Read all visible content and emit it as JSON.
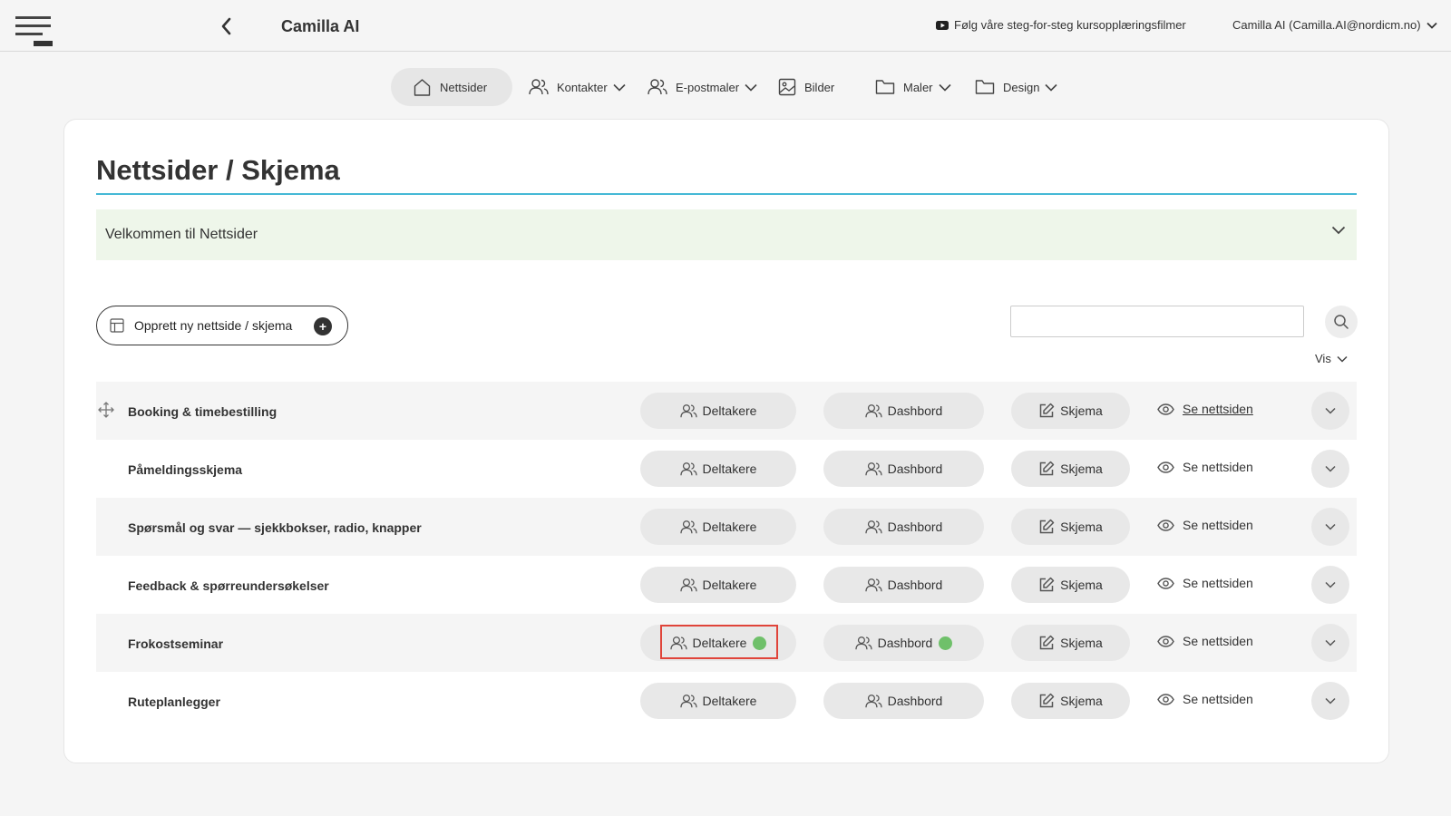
{
  "header": {
    "app_title": "Camilla AI",
    "tutorial_link": "Følg våre steg-for-steg kursopplæringsfilmer",
    "user_label": "Camilla AI (Camilla.AI@nordicm.no)"
  },
  "nav": {
    "items": [
      {
        "label": "Nettsider",
        "icon": "home-icon",
        "active": true
      },
      {
        "label": "Kontakter",
        "icon": "users-icon",
        "dropdown": true
      },
      {
        "label": "E-postmaler",
        "icon": "users-icon",
        "dropdown": true
      },
      {
        "label": "Bilder",
        "icon": "image-icon"
      },
      {
        "label": "Maler",
        "icon": "folder-icon",
        "dropdown": true
      },
      {
        "label": "Design",
        "icon": "folder-icon",
        "dropdown": true
      }
    ]
  },
  "main": {
    "page_title": "Nettsider / Skjema",
    "welcome_label": "Velkommen til Nettsider",
    "create_button_label": "Opprett ny nettside / skjema",
    "search_value": "",
    "view_dropdown_label": "Vis"
  },
  "row_actions": {
    "participants_label": "Deltakere",
    "dashboard_label": "Dashbord",
    "form_label": "Skjema",
    "view_label": "Se nettsiden"
  },
  "rows": [
    {
      "title": "Booking & timebestilling"
    },
    {
      "title": "Påmeldingsskjema"
    },
    {
      "title": "Spørsmål og svar — sjekkbokser, radio, knapper"
    },
    {
      "title": "Feedback & spørreundersøkelser"
    },
    {
      "title": "Frokostseminar"
    },
    {
      "title": "Ruteplanlegger"
    }
  ],
  "colors": {
    "accent_line": "#45b8d6",
    "status_dot": "#6fc06a",
    "highlight_box": "#e0443a",
    "welcome_bg": "#eef6ea"
  }
}
